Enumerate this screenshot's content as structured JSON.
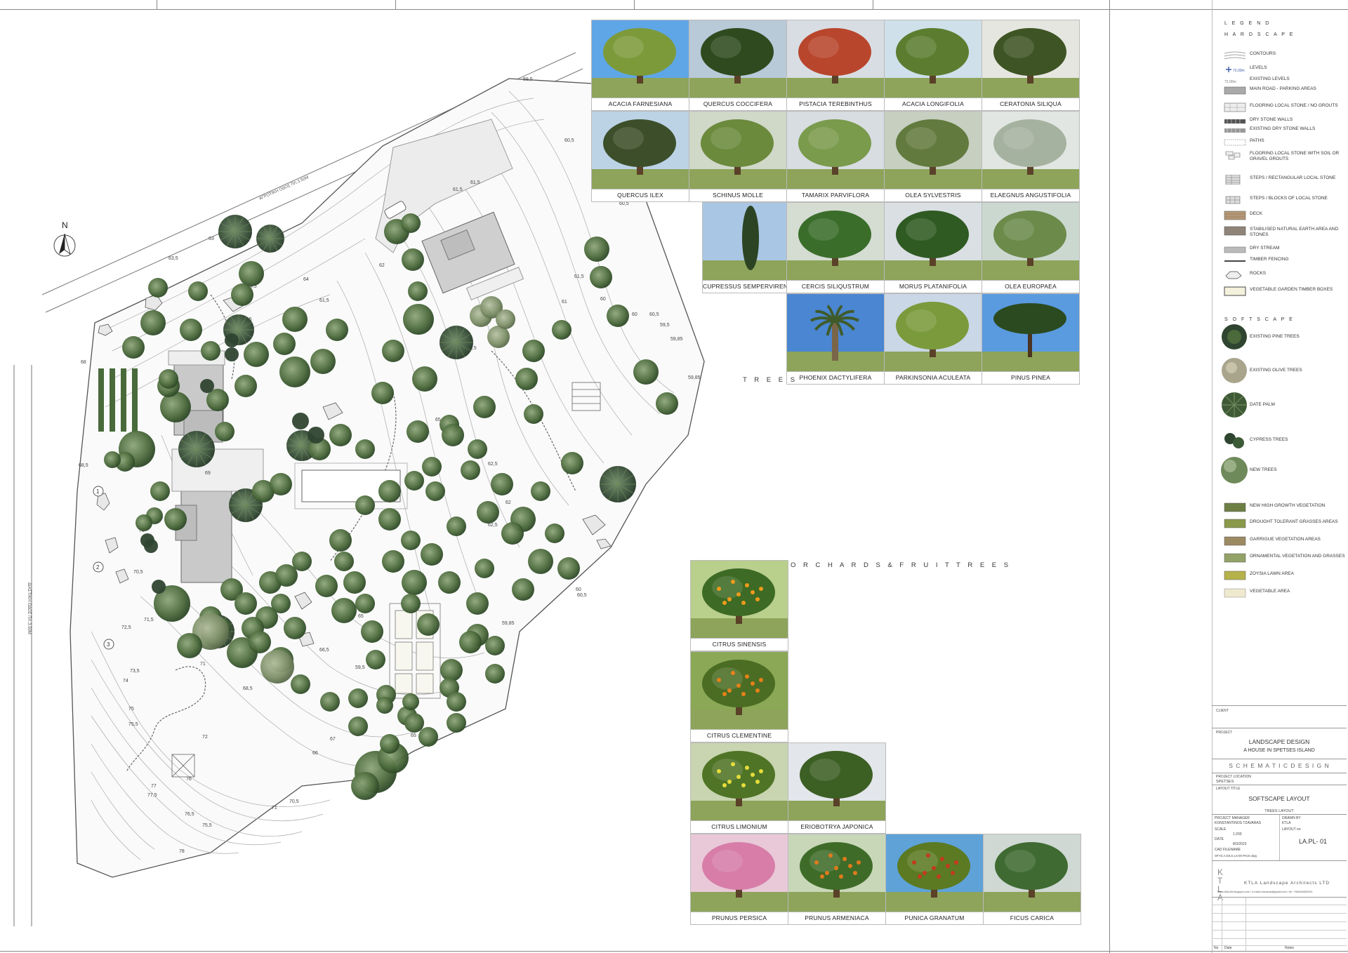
{
  "plan": {
    "north_label": "N",
    "road_labels": [
      "ΑΓΡΟΤΙΚΗ ΟΔΟΣ ΠΛ.3.50Μ",
      "ΔΙΑΣΤΙΚΗ ΟΔΟΣ ΠΛ.3.50Μ"
    ],
    "contour_levels": [
      "63",
      "63,5",
      "64",
      "64,5",
      "65",
      "66",
      "66,5",
      "67",
      "68",
      "68,5",
      "69",
      "70",
      "70,5",
      "71",
      "71,5",
      "72",
      "72,5",
      "73",
      "73,5",
      "74",
      "75",
      "75,5",
      "76",
      "76,5",
      "77",
      "77,5",
      "78",
      "60",
      "60,5",
      "61",
      "61,5",
      "62",
      "62,5",
      "63,5",
      "65,5",
      "59,5",
      "59,85",
      "61,5"
    ],
    "markers": [
      "1",
      "2",
      "3"
    ]
  },
  "trees_section": {
    "title": "T R E E S",
    "species": [
      {
        "name": "ACACIA FARNESIANA",
        "sky": "#5fa6e6",
        "foliage": "#7d9a3a"
      },
      {
        "name": "QUERCUS COCCIFERA",
        "sky": "#b8c9d8",
        "foliage": "#2f4a1e"
      },
      {
        "name": "PISTACIA TEREBINTHUS",
        "sky": "#d8dde3",
        "foliage": "#b8462c"
      },
      {
        "name": "ACACIA LONGIFOLIA",
        "sky": "#cfe0ea",
        "foliage": "#5c7d2f"
      },
      {
        "name": "CERATONIA SILIQUA",
        "sky": "#e6e6e0",
        "foliage": "#3e5424"
      },
      {
        "name": "QUERCUS ILEX",
        "sky": "#bcd3e6",
        "foliage": "#3d4f2a"
      },
      {
        "name": "SCHINUS MOLLE",
        "sky": "#d0d8c8",
        "foliage": "#6b8a3c"
      },
      {
        "name": "TAMARIX PARVIFLORA",
        "sky": "#d7dde1",
        "foliage": "#7a9a4c"
      },
      {
        "name": "OLEA SYLVESTRIS",
        "sky": "#c6cfc0",
        "foliage": "#627a3e"
      },
      {
        "name": "ELAEGNUS ANGUSTIFOLIA",
        "sky": "#e2e6e2",
        "foliage": "#a6b2a0"
      },
      {
        "name": "CUPRESSUS SEMPERVIRENS",
        "sky": "#a9c6e4",
        "foliage": "#2c4423"
      },
      {
        "name": "CERCIS SILIQUSTRUM",
        "sky": "#d5dcd2",
        "foliage": "#3a6d2a"
      },
      {
        "name": "MORUS PLATANIFOLIA",
        "sky": "#d9dfe3",
        "foliage": "#2f5a22"
      },
      {
        "name": "OLEA EUROPAEA",
        "sky": "#cbd8d0",
        "foliage": "#6c8a4a"
      },
      {
        "name": "PHOENIX DACTYLIFERA",
        "sky": "#4a86d1",
        "foliage": "#3f5b2a"
      },
      {
        "name": "PARKINSONIA ACULEATA",
        "sky": "#c9d7e6",
        "foliage": "#7b9a3c"
      },
      {
        "name": "PINUS PINEA",
        "sky": "#5a9be0",
        "foliage": "#2c4a20"
      }
    ]
  },
  "orchards_section": {
    "title": "O R C H A R D S   &   F R U I T   T R E E S",
    "species": [
      {
        "name": "CITRUS SINENSIS",
        "sky": "#b9cf8c",
        "foliage": "#3d6a24",
        "fruit": "#f09a1a"
      },
      {
        "name": "CITRUS CLEMENTINE",
        "sky": "#8aa855",
        "foliage": "#4b6d23",
        "fruit": "#e8801a"
      },
      {
        "name": "CITRUS LIMONIUM",
        "sky": "#c8d5b0",
        "foliage": "#4f7426",
        "fruit": "#e6dd3a"
      },
      {
        "name": "ERIOBOTRYA JAPONICA",
        "sky": "#e3e6ea",
        "foliage": "#3c5f24",
        "fruit": ""
      },
      {
        "name": "PRUNUS PERSICA",
        "sky": "#e9c9d8",
        "foliage": "#d77da8",
        "fruit": ""
      },
      {
        "name": "PRUNUS ARMENIACA",
        "sky": "#c8d7b8",
        "foliage": "#3f6b28",
        "fruit": "#e07a1c"
      },
      {
        "name": "PUNICA GRANATUM",
        "sky": "#5ea2d8",
        "foliage": "#5c7a22",
        "fruit": "#c43a1e"
      },
      {
        "name": "FICUS CARICA",
        "sky": "#cfd8d3",
        "foliage": "#3f6a32",
        "fruit": ""
      }
    ]
  },
  "legend": {
    "title": "L E G E N D",
    "hardscape_title": "H A R D S C A P E",
    "hardscape": [
      "CONTOURS",
      "LEVELS",
      "EXISTING LEVELS",
      "MAIN ROAD - PARKING AREAS",
      "FLOORING LOCAL STONE / NO GROUTS",
      "DRY STONE WALLS",
      "EXISTING DRY STONE WALLS",
      "PATHS",
      "FLOORING LOCAL STONE WITH SOIL OR GRAVEL GROUTS",
      "STEPS / RECTANGULAR LOCAL STONE",
      "STEPS / BLOCKS OF LOCAL STONE",
      "DECK",
      "STABILISED NATURAL EARTH AREA AND STONES",
      "DRY STREAM",
      "TIMBER FENCING",
      "ROCKS",
      "VEGETABLE GARDEN TIMBER BOXES"
    ],
    "level_sample": "72,00m",
    "existing_level_sample": "72,00m",
    "softscape_title": "S O F T S C A P E",
    "softscape": [
      "EXISTING PINE TREES",
      "EXISTING OLIVE TREES",
      "DATE PALM",
      "CYPRESS TREES",
      "NEW TREES",
      "NEW HIGH GROWTH VEGETATION",
      "DROUGHT TOLERANT GRASSES AREAS",
      "GARRIGUE VEGETATION AREAS",
      "ORNAMENTAL VEGETATION AND GRASSES",
      "ZOYSIA LAWN AREA",
      "VEGETABLE AREA"
    ]
  },
  "title_block": {
    "client_label": "CLIENT",
    "project_label": "PROJECT",
    "project_title": "LANDSCAPE DESIGN",
    "project_subtitle": "A HOUSE IN SPETSES ISLAND",
    "stage": "S C H E M A T I C   D E S I G N",
    "location_label": "PROJECT LOCATION",
    "location": "SPETSES",
    "layout_label": "LAYOUT TITLE",
    "layout_title": "SOFTSCAPE LAYOUT",
    "layout_subtitle": "TREES LAYOUT",
    "manager_label": "PROJECT MANAGER",
    "manager": "KONSTANTINOS TZAVARAS",
    "drawn_label": "DRAWN BY",
    "drawn": "KTLA",
    "scale_label": "SCALE",
    "scale": "1:200",
    "date_label": "DATE",
    "date": "8/3/2023",
    "file_label": "CAD FILENAME",
    "file": "SP.TZ.A.DS.D.LS-00 PACK.dwg",
    "sheet_label": "LAYOUT no",
    "sheet": "LA.PL- 01",
    "firm_logo": "K T L A",
    "firm_name": "KTLA Landscape Architects LTD",
    "firm_contact": "https://kila.ltd.blogspot.com / e-mail:k.tzavaras@gmail.com / tel: +306944552001",
    "rev_no": "No",
    "rev_date": "Date",
    "rev_notes": "Notes"
  }
}
